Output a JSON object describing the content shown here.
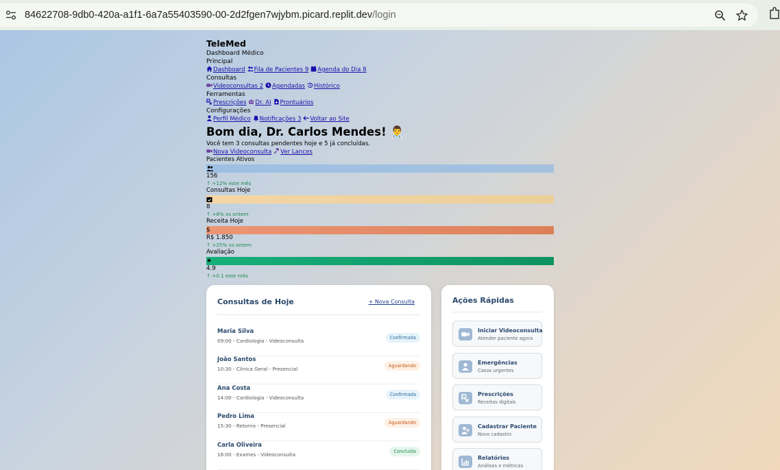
{
  "browser": {
    "url_host": "84622708-9db0-420a-a1f1-6a7a55403590-00-2d2fgen7wjybm.picard.replit.dev",
    "url_path": "/login"
  },
  "brand": {
    "name": "TeleMed",
    "subtitle": "Dashboard Médico"
  },
  "nav": {
    "sections": [
      {
        "title": "Principal",
        "items": [
          "Dashboard",
          "Fila de Pacientes 9",
          "Agenda do Dia 8"
        ]
      },
      {
        "title": "Consultas",
        "items": [
          "Videoconsultas 2",
          "Agendadas",
          "Histórico"
        ]
      },
      {
        "title": "Ferramentas",
        "items": [
          "Prescrições",
          "Dr. AI",
          "Prontuários"
        ]
      },
      {
        "title": "Configurações",
        "items": [
          "Perfil Médico",
          "Notificações 3",
          "Voltar ao Site"
        ]
      }
    ]
  },
  "welcome": {
    "greeting": "Bom dia, Dr. Carlos Mendes! 👨‍⚕️",
    "summary": "Você tem 3 consultas pendentes hoje e 5 já concluídas.",
    "actions": [
      "Nova Videoconsulta",
      "Ver Lances"
    ]
  },
  "stats": [
    {
      "label": "Pacientes Ativos",
      "value": "156",
      "trend": "↑ +12% este mês",
      "color": "#9dbfe2"
    },
    {
      "label": "Consultas Hoje",
      "value": "8",
      "trend": "↑ +8% vs ontem",
      "color": "#f0d4a0"
    },
    {
      "label": "Receita Hoje",
      "value": "R$ 1.850",
      "trend": "↑ +25% vs ontem",
      "color": "#e8906a"
    },
    {
      "label": "Avaliação",
      "value": "4.9",
      "trend": "↑ +0.1 este mês",
      "color": "#12a46e"
    }
  ],
  "consultas": {
    "title": "Consultas de Hoje",
    "new_label": "+ Nova Consulta",
    "rows": [
      {
        "name": "Maria Silva",
        "meta": "09:00 - Cardiologia - Videoconsulta",
        "status": "Confirmada"
      },
      {
        "name": "João Santos",
        "meta": "10:30 - Clínica Geral - Presencial",
        "status": "Aguardando"
      },
      {
        "name": "Ana Costa",
        "meta": "14:00 - Cardiologia - Videoconsulta",
        "status": "Confirmada"
      },
      {
        "name": "Pedro Lima",
        "meta": "15:30 - Retorno - Presencial",
        "status": "Aguardando"
      },
      {
        "name": "Carla Oliveira",
        "meta": "16:00 - Exames - Videoconsulta",
        "status": "Concluída"
      }
    ]
  },
  "acoes": {
    "title": "Ações Rápidas",
    "items": [
      {
        "title": "Iniciar Videoconsulta",
        "desc": "Atender paciente agora",
        "icon": "video-icon"
      },
      {
        "title": "Emergências",
        "desc": "Casos urgentes",
        "icon": "user-alert-icon"
      },
      {
        "title": "Prescrições",
        "desc": "Receitas digitais",
        "icon": "prescription-icon"
      },
      {
        "title": "Cadastrar Paciente",
        "desc": "Novo cadastro",
        "icon": "user-plus-icon"
      },
      {
        "title": "Relatórios",
        "desc": "Análises e métricas",
        "icon": "chart-icon"
      }
    ]
  }
}
